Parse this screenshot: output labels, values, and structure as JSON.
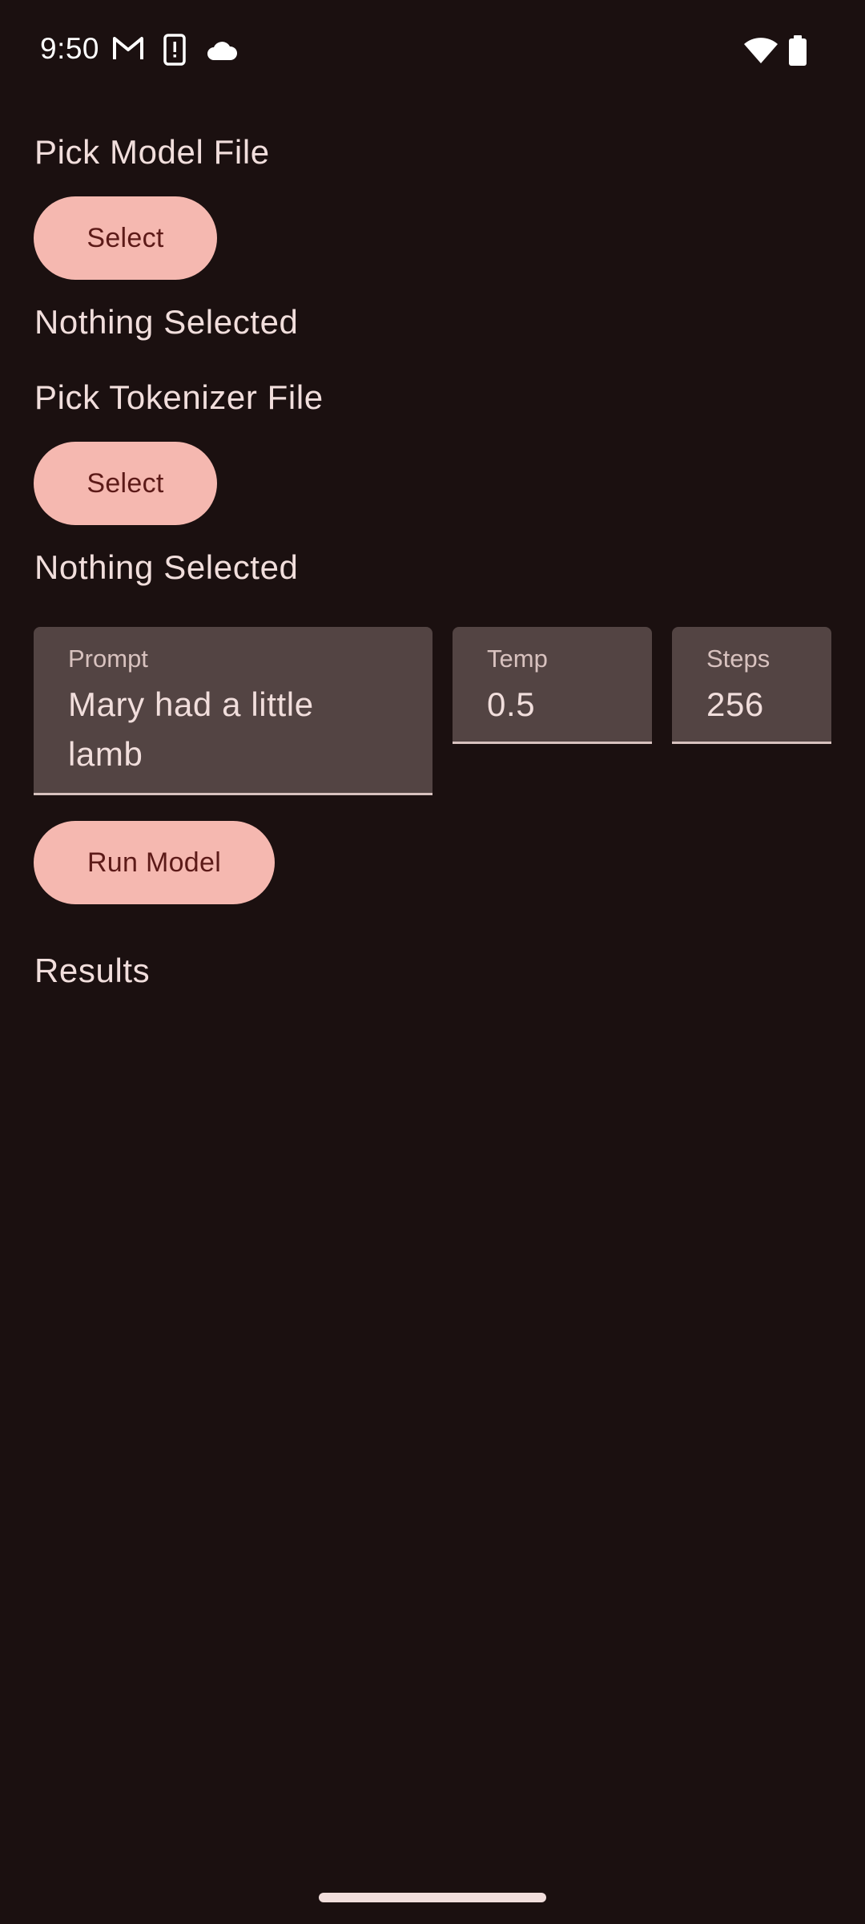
{
  "status_bar": {
    "time": "9:50",
    "icons_left": [
      "gmail-icon",
      "device-alert-icon",
      "cloud-icon"
    ],
    "icons_right": [
      "wifi-icon",
      "battery-icon"
    ]
  },
  "model_section": {
    "label": "Pick Model File",
    "button_label": "Select",
    "selection_text": "Nothing Selected"
  },
  "tokenizer_section": {
    "label": "Pick Tokenizer File",
    "button_label": "Select",
    "selection_text": "Nothing Selected"
  },
  "inputs": {
    "prompt": {
      "label": "Prompt",
      "value_line1": "Mary had a little",
      "value_line2": "lamb"
    },
    "temp": {
      "label": "Temp",
      "value": "0.5"
    },
    "steps": {
      "label": "Steps",
      "value": "256"
    }
  },
  "run_button_label": "Run Model",
  "results_label": "Results",
  "colors": {
    "background": "#1b1010",
    "button": "#f5b8b0",
    "button_text": "#5c1a18",
    "field_bg": "#534443",
    "text": "#f1dedc"
  }
}
